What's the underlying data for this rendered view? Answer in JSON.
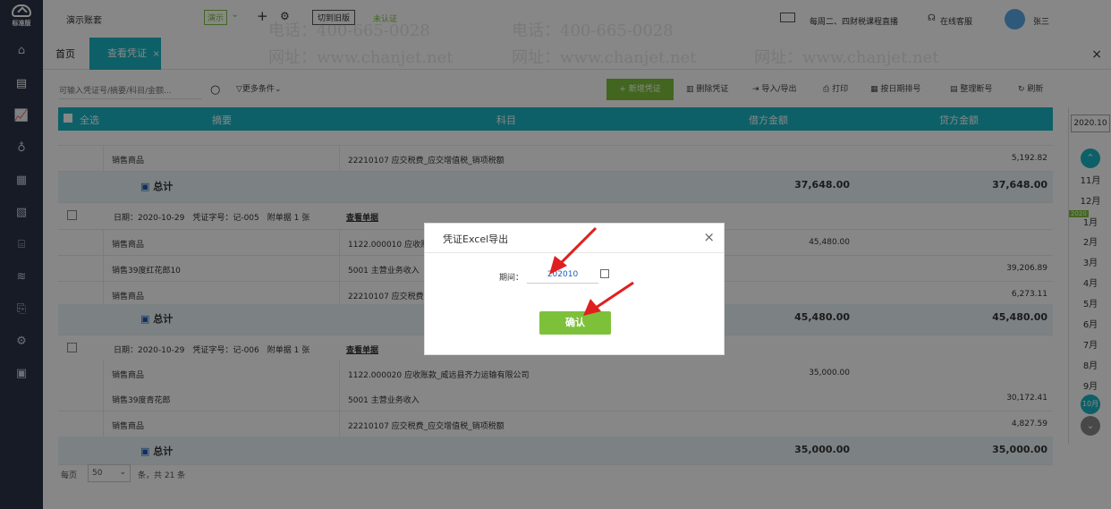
{
  "topbar": {
    "account_name": "演示账套",
    "mode_badge": "演示",
    "switch_label": "切到旧版",
    "auth_status": "未认证",
    "live_text": "每周二、四财税课程直播",
    "service_text": "在线客服",
    "user_name": "张三"
  },
  "logo_text": "标准版",
  "tabs": {
    "home": "首页",
    "active": "查看凭证",
    "active_close": "×",
    "close_all": "×"
  },
  "toolbar": {
    "search_placeholder": "可输入凭证号/摘要/科目/金额...",
    "more_filter": "更多条件",
    "add_voucher": "+ 新增凭证",
    "delete_voucher": "删除凭证",
    "import_export": "导入/导出",
    "print": "打印",
    "sort_by_date": "按日期排号",
    "reorder": "整理断号",
    "refresh": "刷新"
  },
  "table": {
    "headers": {
      "select_all": "全选",
      "summary": "摘要",
      "account": "科目",
      "debit": "借方金额",
      "credit": "贷方金额"
    },
    "rows": [
      {
        "summary": "销售商品",
        "account": "22210107 应交税费_应交增值税_销项税额",
        "debit": "",
        "credit": "5,192.82"
      }
    ],
    "total1": {
      "label": "总计",
      "debit": "37,648.00",
      "credit": "37,648.00"
    },
    "voucher2": {
      "date": "日期：2020-10-29",
      "number": "凭证字号：记-005",
      "attachments": "附单据 1 张",
      "view": "查看单据",
      "rows": [
        {
          "summary": "销售商品",
          "account": "1122.000010 应收账款",
          "debit": "45,480.00",
          "credit": ""
        },
        {
          "summary": "销售39度红花郎10",
          "account": "5001 主营业务收入",
          "debit": "",
          "credit": "39,206.89"
        },
        {
          "summary": "销售商品",
          "account": "22210107 应交税费",
          "debit": "",
          "credit": "6,273.11"
        }
      ],
      "total": {
        "label": "总计",
        "debit": "45,480.00",
        "credit": "45,480.00"
      }
    },
    "voucher3": {
      "date": "日期：2020-10-29",
      "number": "凭证字号：记-006",
      "attachments": "附单据 1 张",
      "view": "查看单据",
      "rows": [
        {
          "summary": "销售商品",
          "account": "1122.000020 应收账款_威远县齐力运输有限公司",
          "debit": "35,000.00",
          "credit": ""
        },
        {
          "summary": "销售39度青花郎",
          "account": "5001 主营业务收入",
          "debit": "",
          "credit": "30,172.41"
        },
        {
          "summary": "销售商品",
          "account": "22210107 应交税费_应交增值税_销项税额",
          "debit": "",
          "credit": "4,827.59"
        }
      ],
      "total": {
        "label": "总计",
        "debit": "35,000.00",
        "credit": "35,000.00"
      }
    }
  },
  "pager": {
    "per_page_label": "每页",
    "per_page_value": "50",
    "count_text": "条，共 21 条"
  },
  "period_nav": {
    "year_box": "2020.10",
    "months_top": [
      "11月",
      "12月"
    ],
    "year_tag": "2020",
    "months": [
      "1月",
      "2月",
      "3月",
      "4月",
      "5月",
      "6月",
      "7月",
      "8月",
      "9月"
    ],
    "current": "10月"
  },
  "modal": {
    "title": "凭证Excel导出",
    "close": "×",
    "period_label": "期间：",
    "period_value": "202010",
    "confirm": "确认"
  },
  "watermark": {
    "phone": "电话：400-665-0028",
    "site": "网址：www.chanjet.net"
  },
  "colors": {
    "accent": "#19b6c4",
    "sidebar": "#2b3347",
    "confirm": "#7dc13b",
    "arrow": "#e02020"
  }
}
